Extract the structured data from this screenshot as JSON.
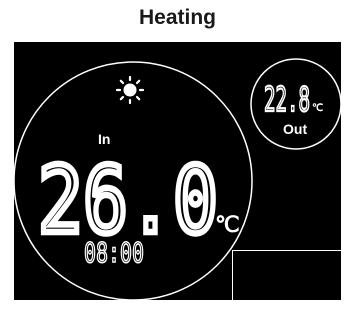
{
  "header": {
    "title": "Heating"
  },
  "display": {
    "mode_icon": "sun-icon",
    "indoor_label": "In",
    "indoor_temperature": "26.0",
    "temperature_unit": "℃",
    "clock": "08:00",
    "outdoor_temperature": "22.8",
    "outdoor_unit": "℃",
    "outdoor_label": "Out"
  },
  "colors": {
    "screen_background": "#000000",
    "segment_color": "#ffffff",
    "page_background": "#ffffff"
  }
}
